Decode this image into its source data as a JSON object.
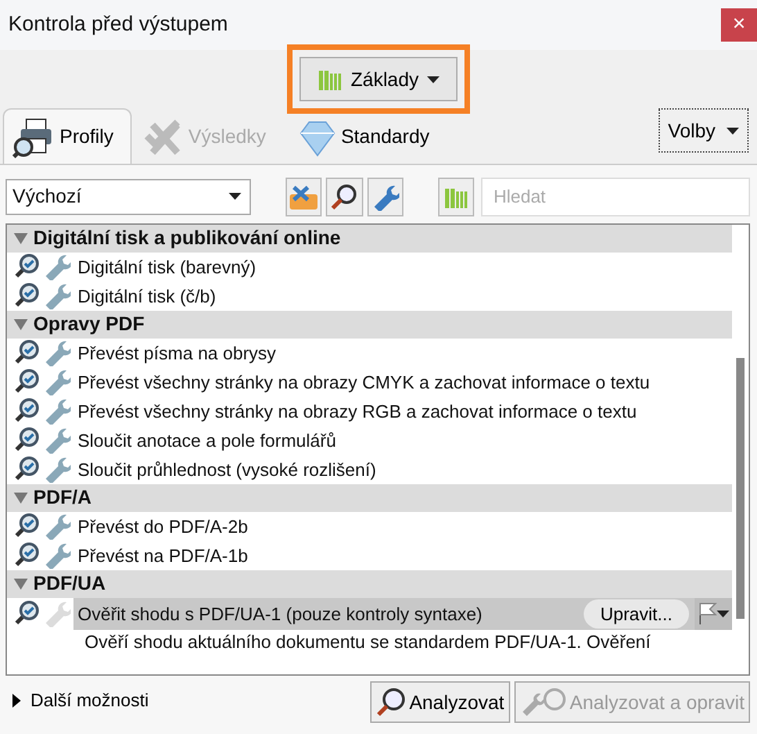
{
  "window": {
    "title": "Kontrola před výstupem",
    "close": "×"
  },
  "view_button": {
    "label": "Základy",
    "highlighted": true
  },
  "tabs": [
    {
      "label": "Profily",
      "selected": true,
      "disabled": false
    },
    {
      "label": "Výsledky",
      "selected": false,
      "disabled": true
    },
    {
      "label": "Standardy",
      "selected": false,
      "disabled": false
    }
  ],
  "options_button": {
    "label": "Volby"
  },
  "profile_select": {
    "value": "Výchozí"
  },
  "search": {
    "placeholder": "Hledat"
  },
  "groups": [
    {
      "title": "Digitální tisk a publikování online",
      "expanded": true,
      "items": [
        {
          "label": "Digitální tisk (barevný)",
          "selected": false,
          "fix": true
        },
        {
          "label": "Digitální tisk (č/b)",
          "selected": false,
          "fix": true
        }
      ]
    },
    {
      "title": "Opravy PDF",
      "expanded": true,
      "items": [
        {
          "label": "Převést písma na obrysy",
          "selected": false,
          "fix": true
        },
        {
          "label": "Převést všechny stránky na obrazy CMYK a zachovat informace o textu",
          "selected": false,
          "fix": true
        },
        {
          "label": "Převést všechny stránky na obrazy RGB a zachovat informace o textu",
          "selected": false,
          "fix": true
        },
        {
          "label": "Sloučit anotace a pole formulářů",
          "selected": false,
          "fix": true
        },
        {
          "label": "Sloučit průhlednost (vysoké rozlišení)",
          "selected": false,
          "fix": true
        }
      ]
    },
    {
      "title": "PDF/A",
      "expanded": true,
      "items": [
        {
          "label": "Převést do PDF/A-2b",
          "selected": false,
          "fix": true
        },
        {
          "label": "Převést na PDF/A-1b",
          "selected": false,
          "fix": true
        }
      ]
    },
    {
      "title": "PDF/UA",
      "expanded": true,
      "items": [
        {
          "label": "Ověřit shodu s PDF/UA-1 (pouze kontroly syntaxe)",
          "selected": true,
          "fix": false,
          "edit_button": "Upravit...",
          "description": "Ověří shodu aktuálního dokumentu se standardem PDF/UA-1. Ověření"
        }
      ]
    }
  ],
  "more_options": {
    "label": "Další možnosti",
    "expanded": false
  },
  "buttons": [
    {
      "label": "Analyzovat",
      "disabled": false
    },
    {
      "label": "Analyzovat a opravit",
      "disabled": true
    }
  ]
}
